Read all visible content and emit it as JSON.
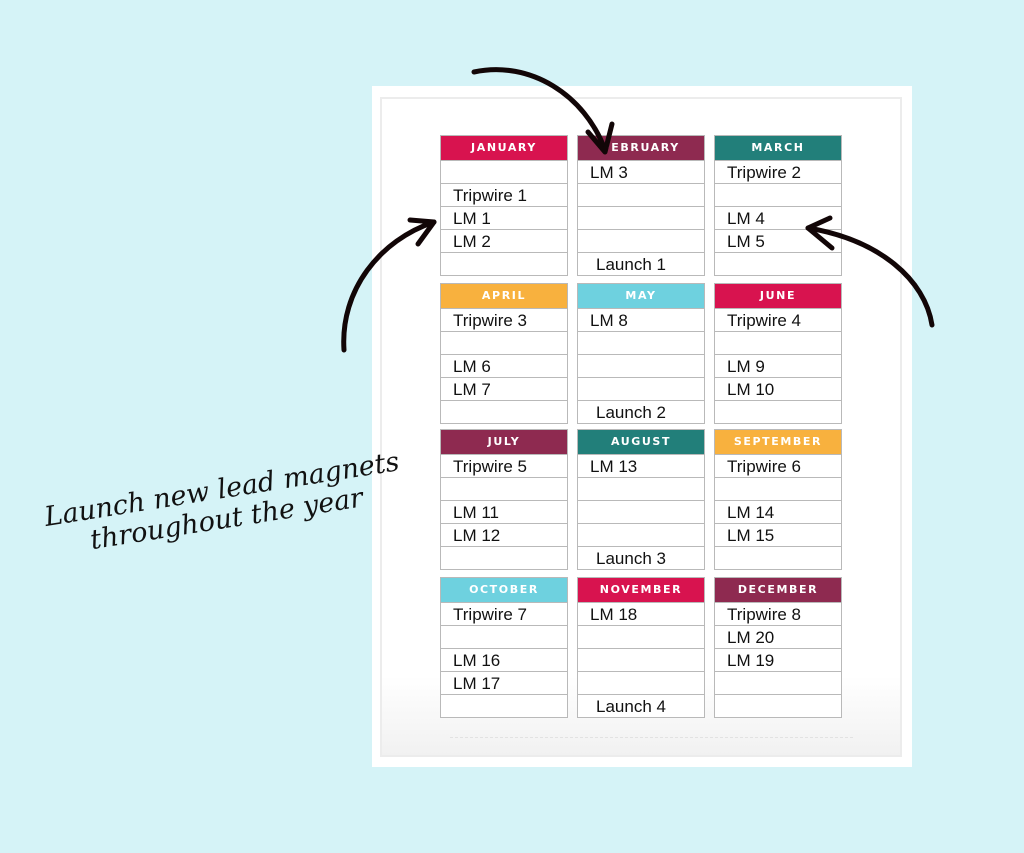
{
  "caption": {
    "line1": "Launch new lead magnets",
    "line2": "throughout the year"
  },
  "colors": {
    "background": "#d5f3f7",
    "crimson": "#d8134f",
    "plum": "#8e2a50",
    "teal": "#227f7a",
    "orange": "#f8b13e",
    "sky": "#6ed1df"
  },
  "months": [
    {
      "name": "JANUARY",
      "color": "#d8134f",
      "entries": [
        {
          "text": "Tripwire 1",
          "row": 1
        },
        {
          "text": "LM 1",
          "row": 2
        },
        {
          "text": "LM 2",
          "row": 3
        }
      ]
    },
    {
      "name": "FEBRUARY",
      "color": "#8e2a50",
      "entries": [
        {
          "text": "LM 3",
          "row": 0
        },
        {
          "text": "Launch 1",
          "row": 4
        }
      ]
    },
    {
      "name": "MARCH",
      "color": "#227f7a",
      "entries": [
        {
          "text": "Tripwire 2",
          "row": 0
        },
        {
          "text": "LM 4",
          "row": 2
        },
        {
          "text": "LM 5",
          "row": 3
        }
      ]
    },
    {
      "name": "APRIL",
      "color": "#f8b13e",
      "entries": [
        {
          "text": "Tripwire 3",
          "row": 0
        },
        {
          "text": "LM 6",
          "row": 2
        },
        {
          "text": "LM 7",
          "row": 3
        }
      ]
    },
    {
      "name": "MAY",
      "color": "#6ed1df",
      "entries": [
        {
          "text": "LM 8",
          "row": 0
        },
        {
          "text": "Launch 2",
          "row": 4
        }
      ]
    },
    {
      "name": "JUNE",
      "color": "#d8134f",
      "entries": [
        {
          "text": "Tripwire 4",
          "row": 0
        },
        {
          "text": "LM 9",
          "row": 2
        },
        {
          "text": "LM 10",
          "row": 3
        }
      ]
    },
    {
      "name": "JULY",
      "color": "#8e2a50",
      "entries": [
        {
          "text": "Tripwire 5",
          "row": 0
        },
        {
          "text": "LM 11",
          "row": 2
        },
        {
          "text": "LM 12",
          "row": 3
        }
      ]
    },
    {
      "name": "AUGUST",
      "color": "#227f7a",
      "entries": [
        {
          "text": "LM 13",
          "row": 0
        },
        {
          "text": "Launch 3",
          "row": 4
        }
      ]
    },
    {
      "name": "SEPTEMBER",
      "color": "#f8b13e",
      "entries": [
        {
          "text": "Tripwire 6",
          "row": 0
        },
        {
          "text": "LM 14",
          "row": 2
        },
        {
          "text": "LM 15",
          "row": 3
        }
      ]
    },
    {
      "name": "OCTOBER",
      "color": "#6ed1df",
      "entries": [
        {
          "text": "Tripwire 7",
          "row": 0
        },
        {
          "text": "LM 16",
          "row": 2
        },
        {
          "text": "LM 17",
          "row": 3
        }
      ]
    },
    {
      "name": "NOVEMBER",
      "color": "#d8134f",
      "entries": [
        {
          "text": "LM 18",
          "row": 0
        },
        {
          "text": "Launch 4",
          "row": 4
        }
      ]
    },
    {
      "name": "DECEMBER",
      "color": "#8e2a50",
      "entries": [
        {
          "text": "Tripwire 8",
          "row": 0
        },
        {
          "text": "LM 20",
          "row": 1
        },
        {
          "text": "LM 19",
          "row": 2
        }
      ]
    }
  ]
}
